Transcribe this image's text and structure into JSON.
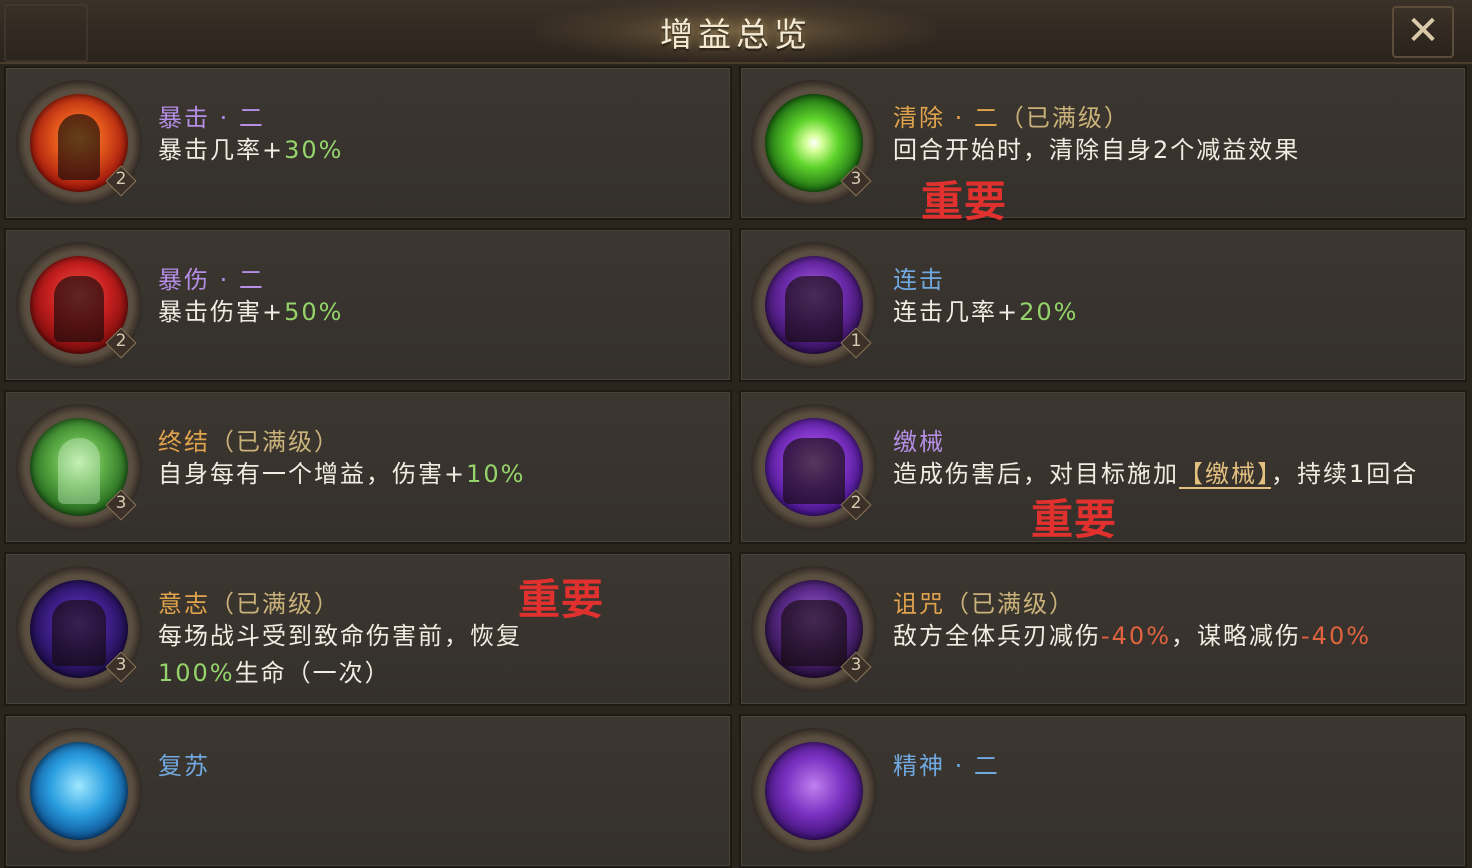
{
  "title": "增益总览",
  "close_label": "✕",
  "important_label": "重要",
  "colors": {
    "purple": "#b58ee6",
    "orange": "#e0a34d",
    "blue": "#70a8e0",
    "value_green": "#95d46b",
    "value_red": "#e0633f",
    "important_red": "#e0312e"
  },
  "buffs": [
    {
      "name": "暴击 · 二",
      "full_note": "",
      "desc_text": "暴击几率+",
      "value": "30%",
      "level": "2",
      "icon": "warrior-flame-icon"
    },
    {
      "name": "清除 · 二",
      "full_note": "（已满级）",
      "desc_text": "回合开始时，清除自身2个减益效果",
      "value": "",
      "level": "3",
      "icon": "green-burst-icon"
    },
    {
      "name": "暴伤 · 二",
      "full_note": "",
      "desc_text": "暴击伤害+",
      "value": "50%",
      "level": "2",
      "icon": "red-warrior-icon"
    },
    {
      "name": "连击",
      "full_note": "",
      "desc_text": "连击几率+",
      "value": "20%",
      "level": "1",
      "icon": "purple-rider-icon"
    },
    {
      "name": "终结",
      "full_note": "（已满级）",
      "desc_text": "自身每有一个增益，伤害+",
      "value": "10%",
      "level": "3",
      "icon": "green-ghost-icon"
    },
    {
      "name": "缴械",
      "full_note": "",
      "desc_text_1": "造成伤害后，对目标施加",
      "tag": "【缴械】",
      "desc_text_2": "，持续1回合",
      "value": "",
      "level": "2",
      "icon": "purple-disarm-icon"
    },
    {
      "name": "意志",
      "full_note": "（已满级）",
      "desc_text_1": "每场战斗受到致命伤害前，恢复",
      "value": "100%",
      "desc_text_2": "生命（一次）",
      "level": "3",
      "icon": "dark-knight-icon"
    },
    {
      "name": "诅咒",
      "full_note": "（已满级）",
      "desc_text_1": "敌方全体兵刃减伤",
      "value": "-40%",
      "desc_text_2": "，谋略减伤",
      "value2": "-40%",
      "level": "3",
      "icon": "curse-soldiers-icon"
    },
    {
      "name": "复苏",
      "icon": "blue-revive-icon"
    },
    {
      "name": "精神 · 二",
      "icon": "purple-spirit-icon"
    }
  ]
}
